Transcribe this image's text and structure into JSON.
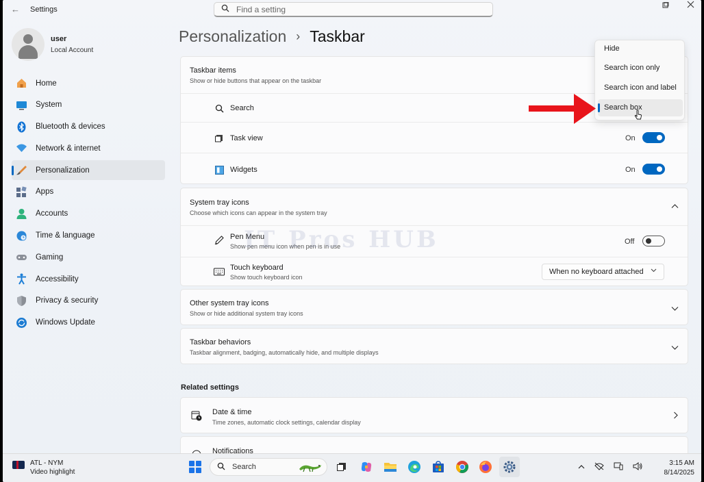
{
  "window": {
    "title": "Settings",
    "search_placeholder": "Find a setting",
    "controls": [
      "—",
      "▢",
      "✕"
    ]
  },
  "profile": {
    "name": "user",
    "account_type": "Local Account"
  },
  "nav": {
    "items": [
      {
        "label": "Home",
        "icon": "home-icon"
      },
      {
        "label": "System",
        "icon": "system-icon"
      },
      {
        "label": "Bluetooth & devices",
        "icon": "bluetooth-icon"
      },
      {
        "label": "Network & internet",
        "icon": "wifi-icon"
      },
      {
        "label": "Personalization",
        "icon": "brush-icon",
        "active": true
      },
      {
        "label": "Apps",
        "icon": "apps-icon"
      },
      {
        "label": "Accounts",
        "icon": "person-icon"
      },
      {
        "label": "Time & language",
        "icon": "clock-globe-icon"
      },
      {
        "label": "Gaming",
        "icon": "gamepad-icon"
      },
      {
        "label": "Accessibility",
        "icon": "accessibility-icon"
      },
      {
        "label": "Privacy & security",
        "icon": "shield-icon"
      },
      {
        "label": "Windows Update",
        "icon": "update-icon"
      }
    ]
  },
  "breadcrumb": {
    "parent": "Personalization",
    "separator": "›",
    "current": "Taskbar"
  },
  "taskbar_items": {
    "title": "Taskbar items",
    "subtitle": "Show or hide buttons that appear on the taskbar",
    "rows": [
      {
        "label": "Search",
        "icon": "search-icon"
      },
      {
        "label": "Task view",
        "icon": "task-view-icon",
        "state": "On"
      },
      {
        "label": "Widgets",
        "icon": "widgets-icon",
        "state": "On"
      }
    ]
  },
  "system_tray": {
    "title": "System tray icons",
    "subtitle": "Choose which icons can appear in the system tray",
    "rows": [
      {
        "label": "Pen Menu",
        "sub": "Show pen menu icon when pen is in use",
        "icon": "pen-icon",
        "state": "Off"
      },
      {
        "label": "Touch keyboard",
        "sub": "Show touch keyboard icon",
        "icon": "keyboard-icon",
        "select": "When no keyboard attached"
      }
    ]
  },
  "other_tray": {
    "title": "Other system tray icons",
    "subtitle": "Show or hide additional system tray icons"
  },
  "behaviors": {
    "title": "Taskbar behaviors",
    "subtitle": "Taskbar alignment, badging, automatically hide, and multiple displays"
  },
  "related": {
    "heading": "Related settings",
    "date_time": {
      "title": "Date & time",
      "subtitle": "Time zones, automatic clock settings, calendar display"
    },
    "notifications": {
      "title": "Notifications"
    }
  },
  "search_menu": {
    "options": [
      "Hide",
      "Search icon only",
      "Search icon and label",
      "Search box"
    ],
    "selected": "Search box"
  },
  "watermark": "IT Pros HUB",
  "os_taskbar": {
    "widget_title": "ATL - NYM",
    "widget_sub": "Video highlight",
    "search_label": "Search",
    "time": "3:15 AM",
    "date": "8/14/2025"
  },
  "colors": {
    "accent": "#0067c0",
    "arrow": "#e8141b"
  }
}
